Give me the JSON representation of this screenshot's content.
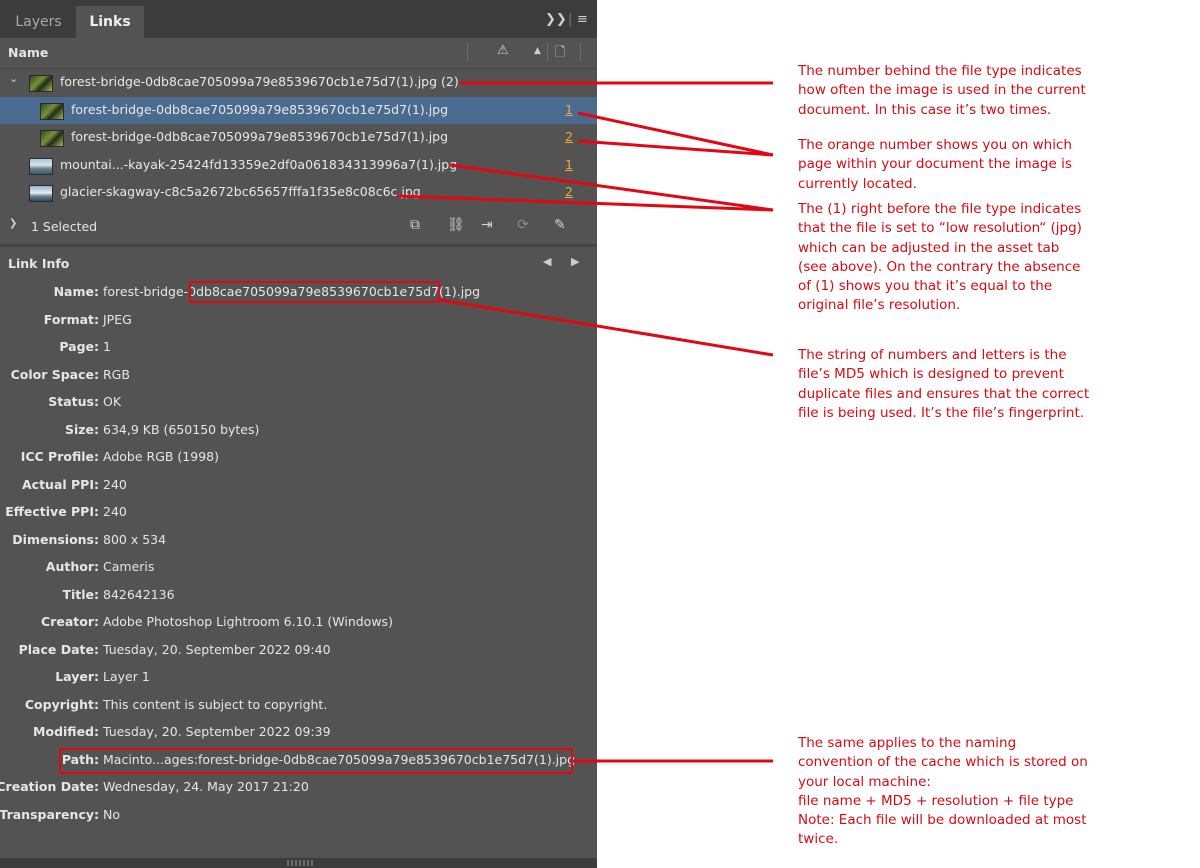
{
  "tabs": [
    {
      "label": "Layers",
      "active": false
    },
    {
      "label": "Links",
      "active": true
    }
  ],
  "header": {
    "name_label": "Name"
  },
  "links": [
    {
      "name": "forest-bridge-0db8cae705099a79e8539670cb1e75d7(1).jpg (2)",
      "page": "",
      "thumb": "forest",
      "expanded": true,
      "child": false,
      "selected": false
    },
    {
      "name": "forest-bridge-0db8cae705099a79e8539670cb1e75d7(1).jpg",
      "page": "1",
      "thumb": "forest",
      "child": true,
      "selected": true
    },
    {
      "name": "forest-bridge-0db8cae705099a79e8539670cb1e75d7(1).jpg",
      "page": "2",
      "thumb": "forest",
      "child": true,
      "selected": false
    },
    {
      "name": "mountai...-kayak-25424fd13359e2df0a061834313996a7(1).jpg",
      "page": "1",
      "thumb": "mountain",
      "child": false,
      "selected": false
    },
    {
      "name": "glacier-skagway-c8c5a2672bc65657fffa1f35e8c08c6c.jpg",
      "page": "2",
      "thumb": "glacier",
      "child": false,
      "selected": false
    }
  ],
  "selection": {
    "count_label": "1 Selected"
  },
  "link_info": {
    "title": "Link Info",
    "fields": [
      {
        "label": "Name:",
        "value": "forest-bridge-0db8cae705099a79e8539670cb1e75d7(1).jpg"
      },
      {
        "label": "Format:",
        "value": "JPEG"
      },
      {
        "label": "Page:",
        "value": "1"
      },
      {
        "label": "Color Space:",
        "value": "RGB"
      },
      {
        "label": "Status:",
        "value": "OK"
      },
      {
        "label": "Size:",
        "value": "634,9 KB (650150 bytes)"
      },
      {
        "label": "ICC Profile:",
        "value": "Adobe RGB (1998)"
      },
      {
        "label": "Actual PPI:",
        "value": "240"
      },
      {
        "label": "Effective PPI:",
        "value": "240"
      },
      {
        "label": "Dimensions:",
        "value": "800 x 534"
      },
      {
        "label": "Author:",
        "value": "Cameris"
      },
      {
        "label": "Title:",
        "value": "842642136"
      },
      {
        "label": "Creator:",
        "value": "Adobe Photoshop Lightroom 6.10.1 (Windows)"
      },
      {
        "label": "Place Date:",
        "value": "Tuesday, 20. September 2022 09:40"
      },
      {
        "label": "Layer:",
        "value": "Layer 1"
      },
      {
        "label": "Copyright:",
        "value": "This content is subject to copyright."
      },
      {
        "label": "Modified:",
        "value": "Tuesday, 20. September 2022 09:39"
      },
      {
        "label": "Path:",
        "value": "Macinto...ages:forest-bridge-0db8cae705099a79e8539670cb1e75d7(1).jpg"
      },
      {
        "label": "Creation Date:",
        "value": "Wednesday, 24. May 2017 21:20"
      },
      {
        "label": "Transparency:",
        "value": "No"
      }
    ]
  },
  "annotations": [
    {
      "text": "The number behind the file type indicates how often the image is used in the current document. In this case it’s two times."
    },
    {
      "text": "The orange number shows you on which page within your document the image is currently located."
    },
    {
      "text": "The (1) right before the file type indicates that the file is set to “low resolution“ (jpg) which can be adjusted in the asset tab (see above). On the contrary the absence of (1) shows you that it’s equal to the original file’s resolution."
    },
    {
      "text": "The string of numbers and letters is the file’s MD5 which is designed to prevent duplicate files and ensures that the correct file is being used. It’s the file’s fingerprint."
    },
    {
      "text": "The same applies to the naming convention of the cache which is stored on your local machine:\nfile name + MD5 + resolution + file type\nNote: Each file will be downloaded at most twice."
    }
  ],
  "colors": {
    "panel": "#535353",
    "selected_row": "#4b6a8f",
    "page_number": "#f4a73b",
    "annotation": "#d60b14"
  },
  "icons": [
    "collapse-panel-icon",
    "panel-menu-icon",
    "warning-icon",
    "sort-arrow-icon",
    "page-icon",
    "relink-from-cc-icon",
    "relink-icon",
    "goto-link-icon",
    "update-link-icon",
    "edit-original-icon",
    "previous-arrow-icon",
    "next-arrow-icon"
  ]
}
